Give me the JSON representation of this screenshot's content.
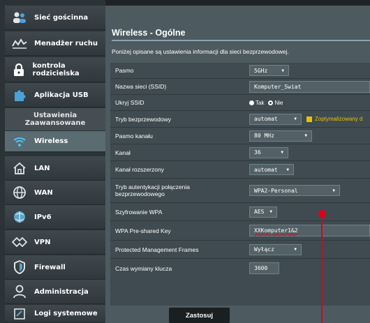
{
  "sidebar": {
    "items": [
      {
        "label": "Sieć gościnna",
        "icon": "guest-network-icon"
      },
      {
        "label": "Menadżer ruchu",
        "icon": "traffic-manager-icon"
      },
      {
        "label": "kontrola rodzicielska",
        "icon": "lock-icon"
      },
      {
        "label": "Aplikacja USB",
        "icon": "puzzle-icon"
      }
    ],
    "advanced_header": "Ustawienia Zaawansowane",
    "advanced_items": [
      {
        "label": "Wireless",
        "icon": "wifi-icon"
      },
      {
        "label": "LAN",
        "icon": "home-icon"
      },
      {
        "label": "WAN",
        "icon": "globe-icon"
      },
      {
        "label": "IPv6",
        "icon": "ipv6-globe-icon"
      },
      {
        "label": "VPN",
        "icon": "vpn-icon"
      },
      {
        "label": "Firewall",
        "icon": "shield-icon"
      },
      {
        "label": "Administracja",
        "icon": "user-admin-icon"
      },
      {
        "label": "Logi systemowe",
        "icon": "log-icon"
      }
    ]
  },
  "main": {
    "title": "Wireless - Ogólne",
    "description": "Poniżej opisane są ustawienia informacji dla sieci bezprzewodowej.",
    "rows": {
      "band": {
        "label": "Pasmo",
        "value": "5GHz"
      },
      "ssid": {
        "label": "Nazwa sieci (SSID)",
        "value": "Komputer_Swiat"
      },
      "hide_ssid": {
        "label": "Ukryj SSID",
        "yes": "Tak",
        "no": "Nie"
      },
      "mode": {
        "label": "Tryb bezprzewodowy",
        "value": "automat",
        "option": "Zoptymalizowany d"
      },
      "bandwidth": {
        "label": "Pasmo kanału",
        "value": "80 MHz"
      },
      "channel": {
        "label": "Kanał",
        "value": "36"
      },
      "ext_channel": {
        "label": "Kanał rozszerzony",
        "value": "automat"
      },
      "auth": {
        "label": "Tryb autentykacji połączenia bezprzewodowego",
        "value": "WPA2-Personal"
      },
      "encryption": {
        "label": "Szyfrowanie WPA",
        "value": "AES"
      },
      "psk": {
        "label": "WPA Pre-shared Key",
        "value": "XXKomputer1&2"
      },
      "pmf": {
        "label": "Protected Management Frames",
        "value": "Wyłącz"
      },
      "rekey": {
        "label": "Czas wymiany klucza",
        "value": "3600"
      }
    },
    "apply_label": "Zastosuj"
  },
  "colors": {
    "marker": "#e0001b",
    "accent_check": "#e8c100"
  }
}
